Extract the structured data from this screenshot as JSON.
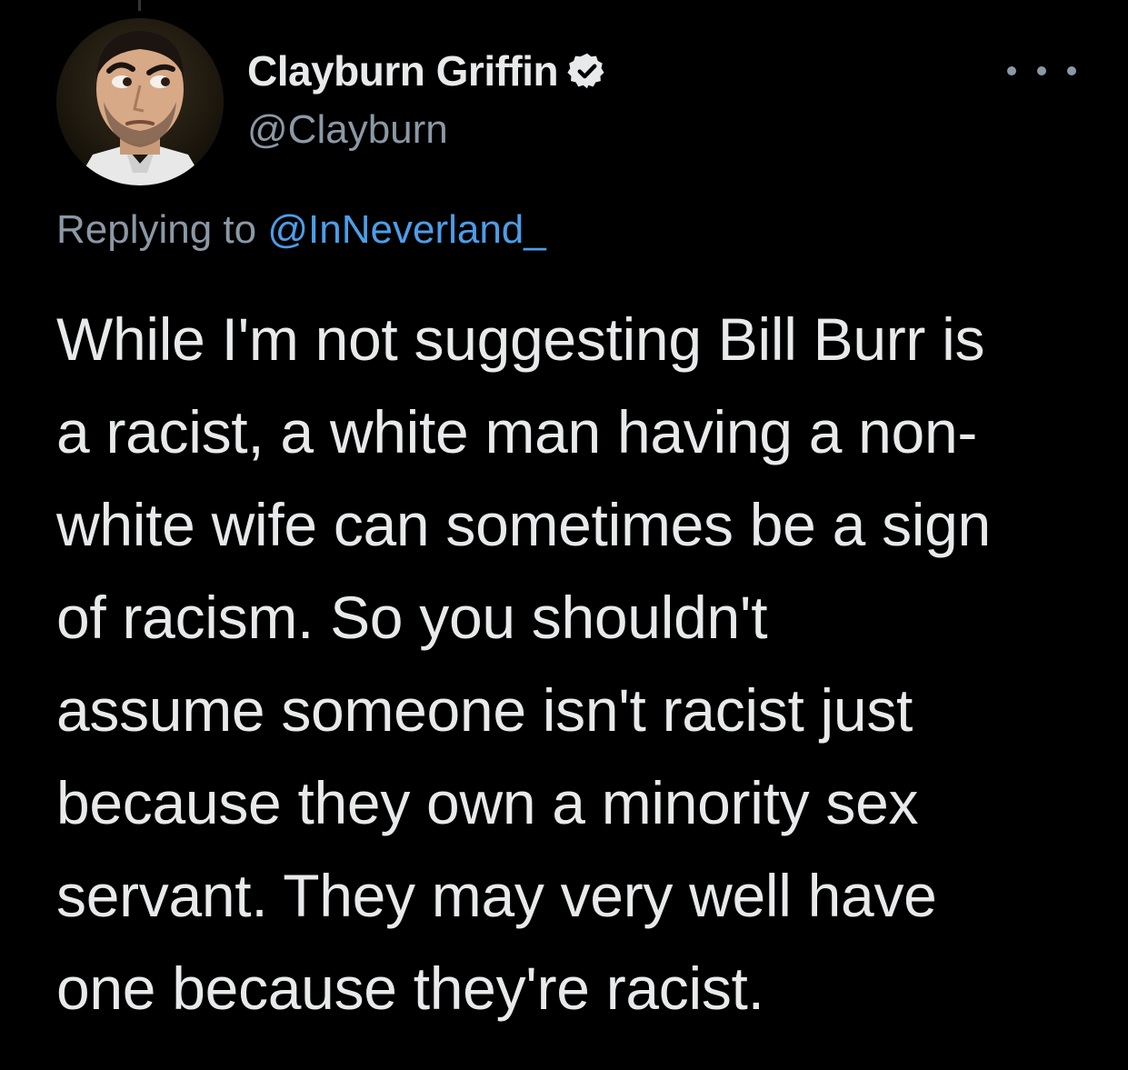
{
  "tweet": {
    "author": {
      "display_name": "Clayburn Griffin",
      "handle": "@Clayburn",
      "verified": true,
      "avatar_icon": "profile-photo"
    },
    "reply": {
      "prefix": "Replying to ",
      "mention": "@InNeverland_"
    },
    "text": "While I'm not suggesting Bill Burr is\na racist, a white man having a non-\nwhite wife can sometimes be a sign\nof racism.  So you shouldn't\nassume someone isn't racist just\nbecause they own a minority sex\nservant.  They may very well have\none because they're racist.",
    "more_icon": "ellipsis-icon"
  },
  "colors": {
    "background": "#000000",
    "text": "#e7e9ea",
    "secondary": "#8b98a5",
    "link": "#4d9de8"
  }
}
